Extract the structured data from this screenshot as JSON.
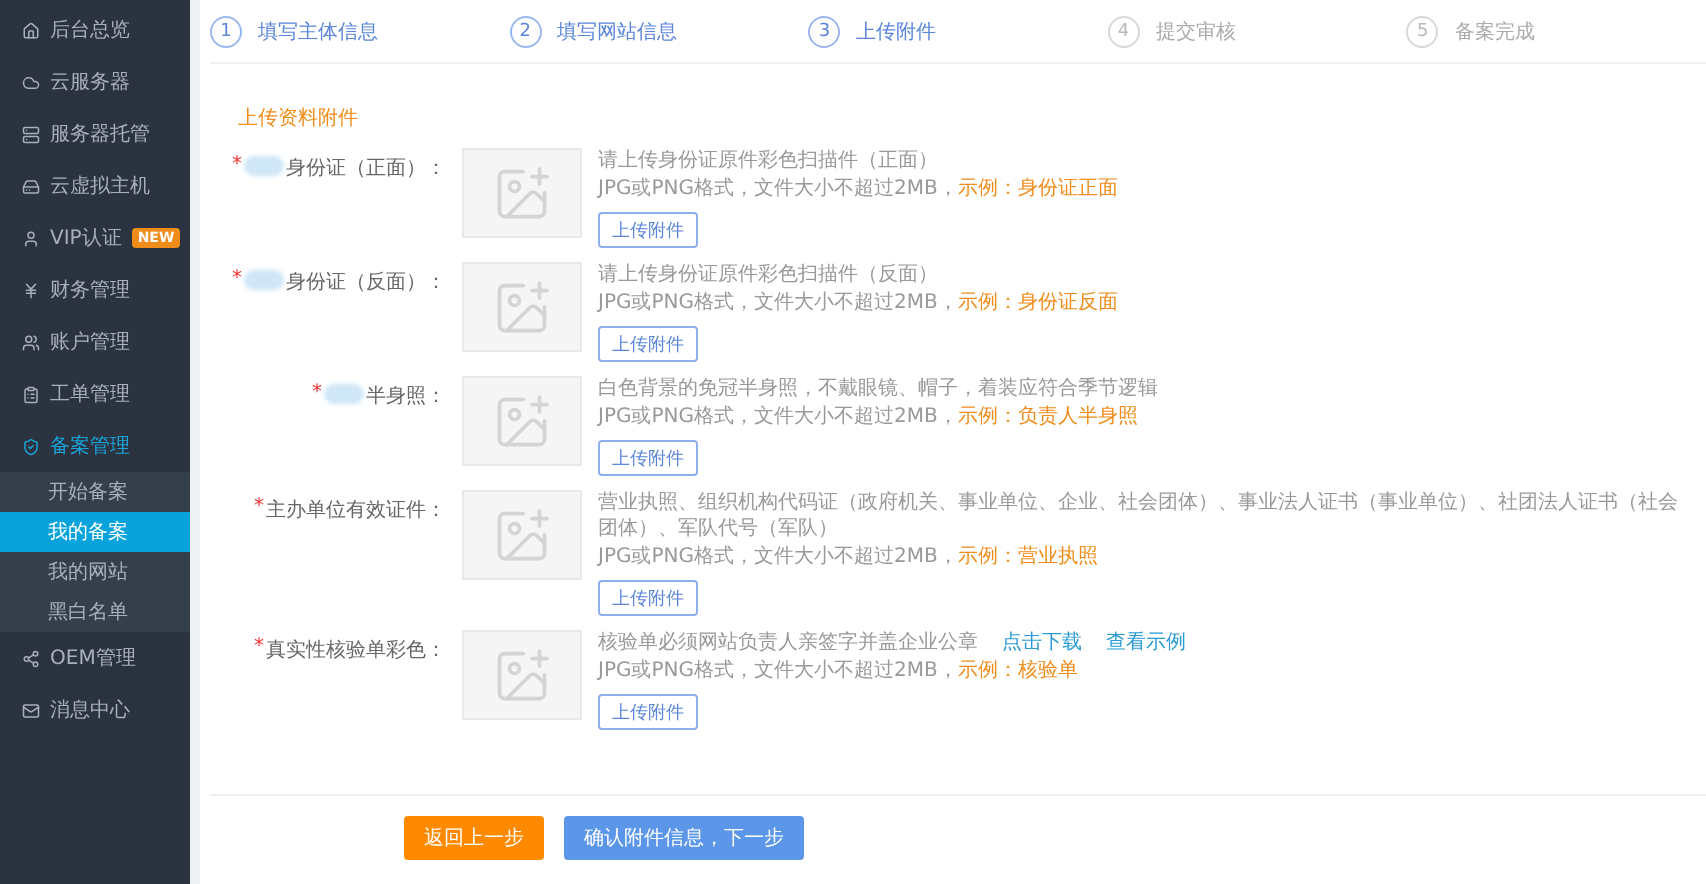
{
  "sidebar": {
    "items": [
      {
        "label": "后台总览",
        "selected": false
      },
      {
        "label": "云服务器",
        "selected": false
      },
      {
        "label": "服务器托管",
        "selected": false
      },
      {
        "label": "云虚拟主机",
        "selected": false
      },
      {
        "label": "VIP认证",
        "badge": "NEW",
        "selected": false
      },
      {
        "label": "财务管理",
        "selected": false
      },
      {
        "label": "账户管理",
        "selected": false
      },
      {
        "label": "工单管理",
        "selected": false
      },
      {
        "label": "备案管理",
        "selected": true,
        "expanded": true,
        "children": [
          {
            "label": "开始备案",
            "selected": false
          },
          {
            "label": "我的备案",
            "selected": true
          },
          {
            "label": "我的网站",
            "selected": false
          },
          {
            "label": "黑白名单",
            "selected": false
          }
        ]
      },
      {
        "label": "OEM管理",
        "selected": false
      },
      {
        "label": "消息中心",
        "selected": false
      }
    ]
  },
  "steps": [
    {
      "number": "1",
      "label": "填写主体信息",
      "active": true
    },
    {
      "number": "2",
      "label": "填写网站信息",
      "active": true
    },
    {
      "number": "3",
      "label": "上传附件",
      "active": true
    },
    {
      "number": "4",
      "label": "提交审核",
      "active": false
    },
    {
      "number": "5",
      "label": "备案完成",
      "active": false
    }
  ],
  "section_title": "上传资料附件",
  "uploads": [
    {
      "label": "身份证（正面）：",
      "required_mark": "*",
      "redacted": true,
      "description": "请上传身份证原件彩色扫描件（正面）",
      "format": "JPG或PNG格式，文件大小不超过2MB，",
      "example": "示例：身份证正面",
      "button": "上传附件"
    },
    {
      "label": "身份证（反面）：",
      "required_mark": "*",
      "redacted": true,
      "description": "请上传身份证原件彩色扫描件（反面）",
      "format": "JPG或PNG格式，文件大小不超过2MB，",
      "example": "示例：身份证反面",
      "button": "上传附件"
    },
    {
      "label": "半身照：",
      "required_mark": "*",
      "redacted": true,
      "description": "白色背景的免冠半身照，不戴眼镜、帽子，着装应符合季节逻辑",
      "format": "JPG或PNG格式，文件大小不超过2MB，",
      "example": "示例：负责人半身照",
      "button": "上传附件"
    },
    {
      "label": "主办单位有效证件：",
      "required_mark": "*",
      "redacted": false,
      "description": "营业执照、组织机构代码证（政府机关、事业单位、企业、社会团体）、事业法人证书（事业单位）、社团法人证书（社会团体）、军队代号（军队）",
      "format": "JPG或PNG格式，文件大小不超过2MB，",
      "example": "示例：营业执照",
      "button": "上传附件"
    },
    {
      "label": "真实性核验单彩色：",
      "required_mark": "*",
      "redacted": false,
      "description": "核验单必须网站负责人亲签字并盖企业公章",
      "links": [
        "点击下载",
        "查看示例"
      ],
      "format": "JPG或PNG格式，文件大小不超过2MB，",
      "example": "示例：核验单",
      "button": "上传附件"
    }
  ],
  "actions": [
    {
      "label": "返回上一步",
      "kind": "secondary"
    },
    {
      "label": "确认附件信息，下一步",
      "kind": "primary"
    }
  ]
}
